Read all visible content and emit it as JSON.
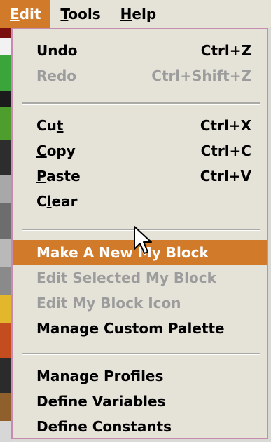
{
  "menubar": {
    "items": [
      {
        "label": "Edit",
        "mnemonic": "E",
        "rest": "dit",
        "active": true
      },
      {
        "label": "Tools",
        "mnemonic": "T",
        "rest": "ools",
        "active": false
      },
      {
        "label": "Help",
        "mnemonic": "H",
        "rest": "elp",
        "active": false
      }
    ]
  },
  "menu": {
    "undo": {
      "label": "Undo",
      "shortcut": "Ctrl+Z"
    },
    "redo": {
      "label": "Redo",
      "shortcut": "Ctrl+Shift+Z"
    },
    "cut": {
      "label_pre": "Cu",
      "label_mn": "t",
      "label_post": "",
      "shortcut": "Ctrl+X"
    },
    "copy": {
      "label_pre": "",
      "label_mn": "C",
      "label_post": "opy",
      "shortcut": "Ctrl+C"
    },
    "paste": {
      "label_pre": "",
      "label_mn": "P",
      "label_post": "aste",
      "shortcut": "Ctrl+V"
    },
    "clear": {
      "label_pre": "C",
      "label_mn": "l",
      "label_post": "ear"
    },
    "make_block": {
      "label": "Make A New My Block"
    },
    "edit_block": {
      "label": "Edit Selected My Block"
    },
    "edit_icon": {
      "label": "Edit My Block Icon"
    },
    "manage_palette": {
      "label": "Manage Custom Palette"
    },
    "manage_profiles": {
      "label": "Manage Profiles"
    },
    "define_variables": {
      "label": "Define Variables"
    },
    "define_constants": {
      "label": "Define Constants"
    }
  },
  "colors": {
    "menu_bg": "#e5e2d8",
    "highlight": "#d07a2a",
    "disabled_text": "#9c9c9c",
    "border": "#c78bb0"
  },
  "icons": {
    "cursor": "arrow-pointer-icon"
  }
}
